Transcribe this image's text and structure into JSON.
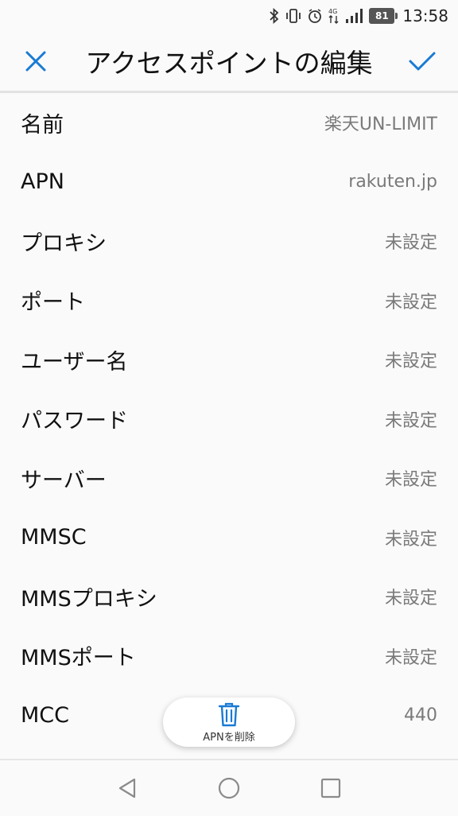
{
  "status_bar": {
    "icons": [
      "bluetooth-icon",
      "vibrate-icon",
      "alarm-icon",
      "4g-signal-icon",
      "signal-bars-icon"
    ],
    "network_type": "4G",
    "battery_level": "81",
    "time": "13:58"
  },
  "app_bar": {
    "title": "アクセスポイントの編集",
    "close_icon": "close-icon",
    "confirm_icon": "check-icon",
    "accent_color": "#1a7ad4"
  },
  "fields": [
    {
      "label": "名前",
      "value": "楽天UN-LIMIT"
    },
    {
      "label": "APN",
      "value": "rakuten.jp"
    },
    {
      "label": "プロキシ",
      "value": "未設定"
    },
    {
      "label": "ポート",
      "value": "未設定"
    },
    {
      "label": "ユーザー名",
      "value": "未設定"
    },
    {
      "label": "パスワード",
      "value": "未設定"
    },
    {
      "label": "サーバー",
      "value": "未設定"
    },
    {
      "label": "MMSC",
      "value": "未設定"
    },
    {
      "label": "MMSプロキシ",
      "value": "未設定"
    },
    {
      "label": "MMSポート",
      "value": "未設定"
    },
    {
      "label": "MCC",
      "value": "440"
    }
  ],
  "delete_button": {
    "label": "APNを削除",
    "icon": "trash-icon"
  },
  "nav_bar": {
    "icons": [
      "back-triangle-icon",
      "home-circle-icon",
      "recents-square-icon"
    ]
  }
}
